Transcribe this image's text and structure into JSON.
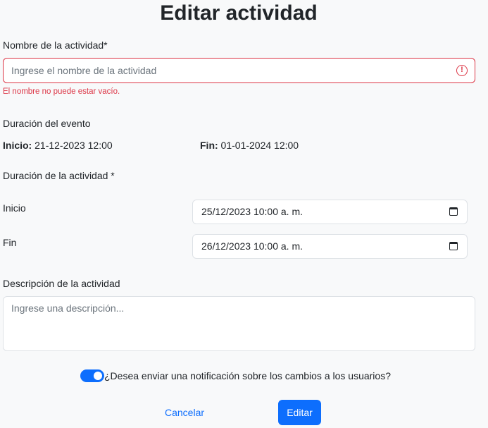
{
  "title": "Editar actividad",
  "name_field": {
    "label": "Nombre de la actividad*",
    "value": "",
    "placeholder": "Ingrese el nombre de la actividad",
    "error": "El nombre no puede estar vacío.",
    "invalid_icon_glyph": "!"
  },
  "event_duration": {
    "label": "Duración del evento",
    "start_label": "Inicio:",
    "start_value": "21-12-2023 12:00",
    "end_label": "Fin:",
    "end_value": "01-01-2024 12:00"
  },
  "activity_duration": {
    "label": "Duración de la actividad *",
    "start_label": "Inicio",
    "start_value": "25/12/2023 10:00  a. m.",
    "end_label": "Fin",
    "end_value": "26/12/2023 10:00  a. m."
  },
  "description": {
    "label": "Descripción de la actividad",
    "value": "",
    "placeholder": "Ingrese una descripción..."
  },
  "notify": {
    "label": "¿Desea enviar una notificación sobre los cambios a los usuarios?",
    "checked": true
  },
  "buttons": {
    "cancel": "Cancelar",
    "submit": "Editar"
  },
  "colors": {
    "primary": "#0d6efd",
    "danger": "#dc3545",
    "background": "#f8f9fa"
  }
}
